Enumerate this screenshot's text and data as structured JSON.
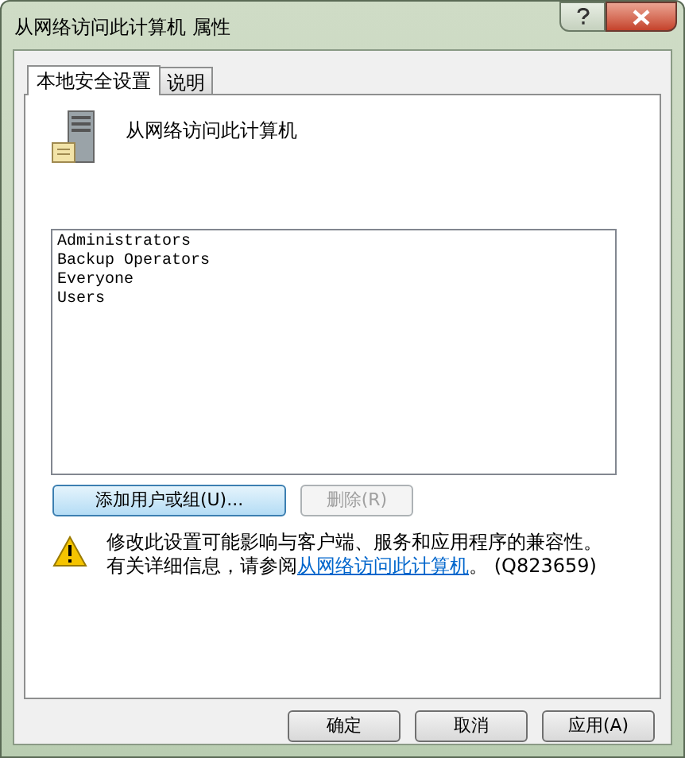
{
  "window": {
    "title": "从网络访问此计算机 属性"
  },
  "tabs": [
    {
      "label": "本地安全设置",
      "selected": true
    },
    {
      "label": "说明",
      "selected": false
    }
  ],
  "policy": {
    "title": "从网络访问此计算机"
  },
  "members": [
    "Administrators",
    "Backup Operators",
    "Everyone",
    "Users"
  ],
  "member_buttons": [
    {
      "label": "添加用户或组(U)...",
      "disabled": false
    },
    {
      "label": "删除(R)",
      "disabled": true
    }
  ],
  "warning": {
    "line_1": "修改此设置可能影响与客户端、服务和应用程序的兼容性。",
    "line_2_start": "有关详细信息，请参阅",
    "link": "从网络访问此计算机",
    "line_2_end": "。 (Q823659)"
  },
  "dialog_buttons": [
    {
      "label": "确定",
      "disabled": false
    },
    {
      "label": "取消",
      "disabled": false
    },
    {
      "label": "应用(A)",
      "disabled": false
    }
  ]
}
